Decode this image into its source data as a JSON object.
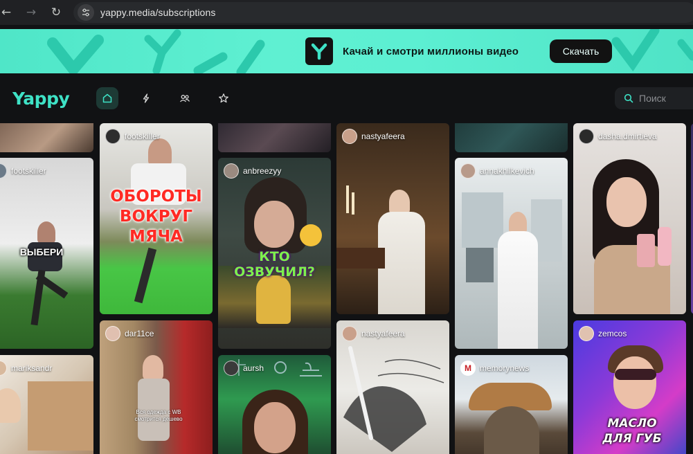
{
  "browser": {
    "url": "yappy.media/subscriptions",
    "icons": {
      "back": "arrow-left-icon",
      "forward": "arrow-right-icon",
      "reload": "reload-icon",
      "site_info": "tune-icon"
    }
  },
  "banner": {
    "text": "Качай и смотри миллионы видео",
    "button_label": "Скачать",
    "accent": "#5cefd2"
  },
  "header": {
    "brand": "Yappy",
    "nav": [
      {
        "name": "home",
        "icon": "home-icon",
        "active": true
      },
      {
        "name": "lightning",
        "icon": "lightning-icon",
        "active": false
      },
      {
        "name": "people",
        "icon": "people-icon",
        "active": false
      },
      {
        "name": "star",
        "icon": "star-icon",
        "active": false
      }
    ],
    "search_placeholder": "Поиск",
    "accent": "#3ee2c6"
  },
  "feed": {
    "cards": [
      {
        "id": "c0a",
        "author": ""
      },
      {
        "id": "c0b",
        "author": "footskiller",
        "overlay": "ВЫБЕРИ"
      },
      {
        "id": "c0c",
        "author": "mariksandr"
      },
      {
        "id": "c1a",
        "author": "footskiller",
        "overlay": "ОБОРОТЫ ВОКРУГ МЯЧА"
      },
      {
        "id": "c1b",
        "author": "dar11ce",
        "overlay": "Вся одежда с WB смотрится дешево"
      },
      {
        "id": "c2a",
        "author": ""
      },
      {
        "id": "c2b",
        "author": "anbreezyy",
        "overlay": "КТО ОЗВУЧИЛ?"
      },
      {
        "id": "c2c",
        "author": "aursh"
      },
      {
        "id": "c3a",
        "author": "nastyafeera"
      },
      {
        "id": "c3b",
        "author": "nastyafeera"
      },
      {
        "id": "c4a",
        "author": ""
      },
      {
        "id": "c4b",
        "author": "annakhilkevich"
      },
      {
        "id": "c4c",
        "author": "memorynews"
      },
      {
        "id": "c5a",
        "author": "dasha.dmirtieva"
      },
      {
        "id": "c5b",
        "author": "zemcos",
        "overlay": "МАСЛО ДЛЯ ГУБ"
      }
    ]
  }
}
